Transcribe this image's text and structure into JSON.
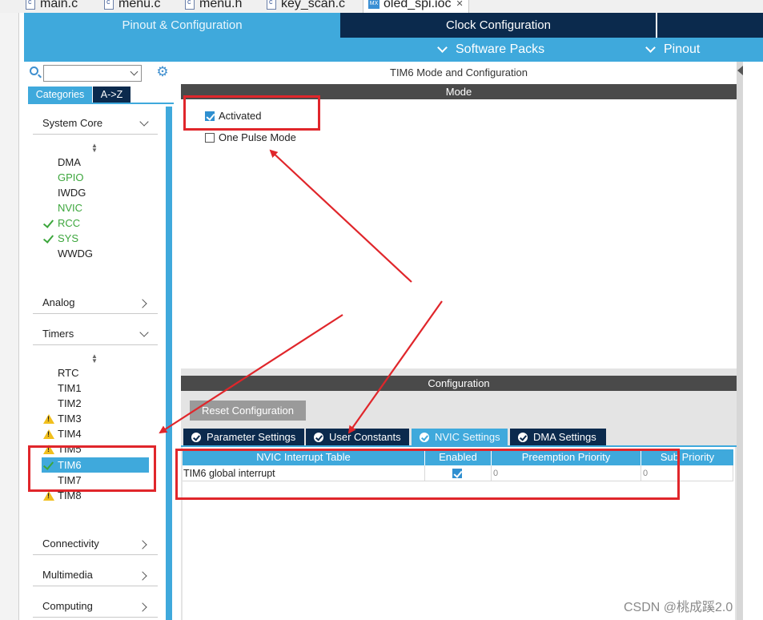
{
  "editor_tabs": [
    {
      "label": "main.c"
    },
    {
      "label": "menu.c"
    },
    {
      "label": "menu.h"
    },
    {
      "label": "key_scan.c"
    },
    {
      "label": "oled_spi.ioc"
    }
  ],
  "main_tabs": {
    "pinout": "Pinout & Configuration",
    "clock": "Clock Configuration"
  },
  "sub_menu": {
    "software_packs": "Software Packs",
    "pinout": "Pinout"
  },
  "left_panel": {
    "category_tabs": {
      "categories": "Categories",
      "az": "A->Z"
    },
    "sections": {
      "system_core": "System Core",
      "analog": "Analog",
      "timers": "Timers",
      "connectivity": "Connectivity",
      "multimedia": "Multimedia",
      "computing": "Computing"
    },
    "system_core_items": [
      {
        "label": "DMA",
        "state": "normal"
      },
      {
        "label": "GPIO",
        "state": "green"
      },
      {
        "label": "IWDG",
        "state": "normal"
      },
      {
        "label": "NVIC",
        "state": "green"
      },
      {
        "label": "RCC",
        "state": "checked"
      },
      {
        "label": "SYS",
        "state": "checked"
      },
      {
        "label": "WWDG",
        "state": "normal"
      }
    ],
    "timer_items": [
      {
        "label": "RTC",
        "state": "normal"
      },
      {
        "label": "TIM1",
        "state": "normal"
      },
      {
        "label": "TIM2",
        "state": "normal"
      },
      {
        "label": "TIM3",
        "state": "warning"
      },
      {
        "label": "TIM4",
        "state": "warning"
      },
      {
        "label": "TIM5",
        "state": "warning"
      },
      {
        "label": "TIM6",
        "state": "selected"
      },
      {
        "label": "TIM7",
        "state": "normal"
      },
      {
        "label": "TIM8",
        "state": "warning"
      }
    ]
  },
  "mode_panel": {
    "title": "TIM6 Mode and Configuration",
    "mode_header": "Mode",
    "activated": {
      "label": "Activated",
      "checked": true
    },
    "one_pulse": {
      "label": "One Pulse Mode",
      "checked": false
    }
  },
  "config_panel": {
    "header": "Configuration",
    "reset_button": "Reset Configuration",
    "tabs": [
      {
        "label": "Parameter Settings",
        "active": false
      },
      {
        "label": "User Constants",
        "active": false
      },
      {
        "label": "NVIC Settings",
        "active": true
      },
      {
        "label": "DMA Settings",
        "active": false
      }
    ],
    "table": {
      "headers": [
        "NVIC Interrupt Table",
        "Enabled",
        "Preemption Priority",
        "Sub Priority"
      ],
      "rows": [
        {
          "name": "TIM6 global interrupt",
          "enabled": true,
          "preemption": "0",
          "sub": "0"
        }
      ]
    }
  },
  "watermark": "CSDN @桃成蹊2.0",
  "colors": {
    "accent": "#3fa9dc",
    "navy": "#0b2a4d",
    "annotation": "#e0262b",
    "ok_green": "#3ca63c",
    "warning": "#f1bf1d"
  }
}
